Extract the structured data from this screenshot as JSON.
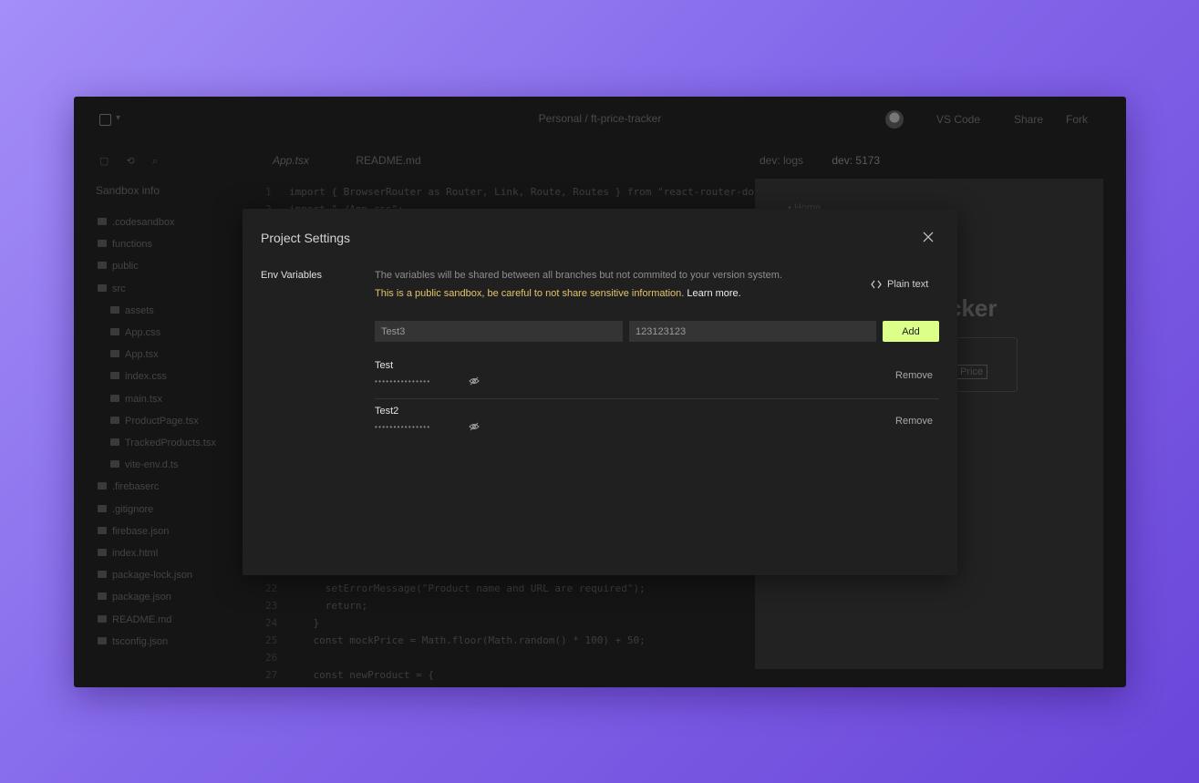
{
  "window": {
    "project_name": "Personal / ft-price-tracker",
    "vscode_label": "VS Code",
    "share_label": "Share",
    "fork_label": "Fork"
  },
  "sidebar": {
    "title": "Sandbox info",
    "files": [
      {
        "name": ".codesandbox",
        "indent": 0,
        "icon": "folder-icon"
      },
      {
        "name": "functions",
        "indent": 0,
        "icon": "folder-icon"
      },
      {
        "name": "public",
        "indent": 0,
        "icon": "folder-icon"
      },
      {
        "name": "src",
        "indent": 0,
        "icon": "folder-open-icon"
      },
      {
        "name": "assets",
        "indent": 1,
        "icon": "folder-icon"
      },
      {
        "name": "App.css",
        "indent": 1,
        "icon": "hash-icon"
      },
      {
        "name": "App.tsx",
        "indent": 1,
        "icon": "code-icon"
      },
      {
        "name": "index.css",
        "indent": 1,
        "icon": "hash-icon"
      },
      {
        "name": "main.tsx",
        "indent": 1,
        "icon": "code-icon"
      },
      {
        "name": "ProductPage.tsx",
        "indent": 1,
        "icon": "code-icon"
      },
      {
        "name": "TrackedProducts.tsx",
        "indent": 1,
        "icon": "code-icon"
      },
      {
        "name": "vite-env.d.ts",
        "indent": 1,
        "icon": "file-icon"
      },
      {
        "name": ".firebaserc",
        "indent": 0,
        "icon": "file-icon"
      },
      {
        "name": ".gitignore",
        "indent": 0,
        "icon": "file-icon"
      },
      {
        "name": "firebase.json",
        "indent": 0,
        "icon": "braces-icon"
      },
      {
        "name": "index.html",
        "indent": 0,
        "icon": "code-icon"
      },
      {
        "name": "package-lock.json",
        "indent": 0,
        "icon": "braces-icon"
      },
      {
        "name": "package.json",
        "indent": 0,
        "icon": "braces-icon"
      },
      {
        "name": "README.md",
        "indent": 0,
        "icon": "file-icon"
      },
      {
        "name": "tsconfig.json",
        "indent": 0,
        "icon": "braces-icon"
      }
    ]
  },
  "editor": {
    "tabs": [
      "App.tsx",
      "README.md"
    ],
    "code_top": [
      {
        "n": "1",
        "text": "import { BrowserRouter as Router, Link, Route, Routes } from \"react-router-do"
      },
      {
        "n": "2",
        "text": "import \"./App.css\";"
      }
    ],
    "code_bottom": [
      {
        "n": "22",
        "text": "      setErrorMessage(\"Product name and URL are required\");"
      },
      {
        "n": "23",
        "text": "      return;"
      },
      {
        "n": "24",
        "text": "    }"
      },
      {
        "n": "25",
        "text": "    const mockPrice = Math.floor(Math.random() * 100) + 50;"
      },
      {
        "n": "26",
        "text": ""
      },
      {
        "n": "27",
        "text": "    const newProduct = {"
      }
    ]
  },
  "preview": {
    "tabs": [
      "dev: logs",
      "dev: 5173"
    ],
    "home_link": "Home",
    "heading_fragment": "cker",
    "price_button": "Price"
  },
  "modal": {
    "title": "Project Settings",
    "nav_item": "Env Variables",
    "description": "The variables will be shared between all branches but not commited to your version system.",
    "warning": "This is a public sandbox, be careful to not share sensitive information.",
    "learn_more": "Learn more.",
    "plain_text_label": "Plain text",
    "name_input_value": "Test3",
    "value_input_value": "123123123",
    "add_label": "Add",
    "variables": [
      {
        "name": "Test",
        "masked": "•••••••••••••••",
        "remove_label": "Remove"
      },
      {
        "name": "Test2",
        "masked": "•••••••••••••••",
        "remove_label": "Remove"
      }
    ]
  },
  "colors": {
    "accent_button": "#dcff8a",
    "warning_text": "#e3c46a",
    "modal_bg": "#202020"
  }
}
